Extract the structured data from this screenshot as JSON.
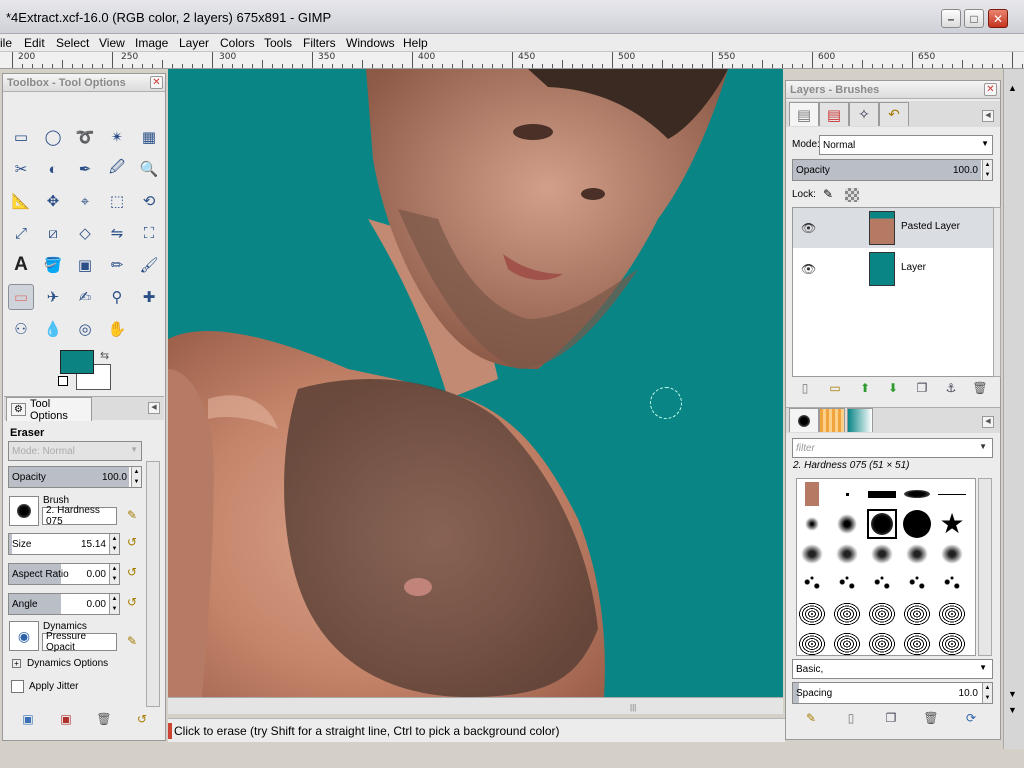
{
  "window": {
    "title": "*4Extract.xcf-16.0 (RGB color, 2 layers) 675x891 - GIMP"
  },
  "menu": [
    "ile",
    "Edit",
    "Select",
    "View",
    "Image",
    "Layer",
    "Colors",
    "Tools",
    "Filters",
    "Windows",
    "Help"
  ],
  "ruler": {
    "labels": [
      "200",
      "250",
      "300",
      "350",
      "400",
      "450",
      "500",
      "550",
      "600",
      "650"
    ]
  },
  "toolbox": {
    "title": "Toolbox - Tool Options",
    "tools": [
      "rect-select",
      "ellipse-select",
      "free-select",
      "fuzzy-select",
      "by-color-select",
      "scissors-select",
      "foreground-select",
      "paths",
      "color-picker",
      "zoom",
      "measure",
      "move",
      "align",
      "crop",
      "rotate",
      "scale",
      "shear",
      "perspective",
      "flip",
      "cage-transform",
      "text",
      "bucket-fill",
      "blend",
      "pencil",
      "paintbrush",
      "eraser",
      "airbrush",
      "ink",
      "clone",
      "heal",
      "perspective-clone",
      "smudge",
      "blur-sharpen",
      "dodge-burn"
    ],
    "selected_tool": "eraser",
    "fg_color": "#0b8383",
    "bg_color": "#ffffff"
  },
  "tool_options": {
    "tab_label": "Tool Options",
    "tool_name": "Eraser",
    "mode_label": "Mode:",
    "mode_value": "Normal",
    "opacity_label": "Opacity",
    "opacity_value": "100.0",
    "brush_label": "Brush",
    "brush_value": "2. Hardness 075",
    "size_label": "Size",
    "size_value": "15.14",
    "aspect_label": "Aspect Ratio",
    "aspect_value": "0.00",
    "angle_label": "Angle",
    "angle_value": "0.00",
    "dynamics_label": "Dynamics",
    "dynamics_value": "Pressure Opacit",
    "dynamics_options_label": "Dynamics Options",
    "apply_jitter_label": "Apply Jitter"
  },
  "status": {
    "message": "Click to erase (try Shift for a straight line, Ctrl to pick a background color)"
  },
  "layers_panel": {
    "title": "Layers - Brushes",
    "mode_label": "Mode:",
    "mode_value": "Normal",
    "opacity_label": "Opacity",
    "opacity_value": "100.0",
    "lock_label": "Lock:",
    "layers": [
      {
        "name": "Pasted Layer",
        "selected": true
      },
      {
        "name": "Layer",
        "selected": false,
        "color": "#098585"
      }
    ]
  },
  "brushes_panel": {
    "filter_placeholder": "filter",
    "selected_brush_label": "2. Hardness 075 (51 × 51)",
    "category_value": "Basic,",
    "spacing_label": "Spacing",
    "spacing_value": "10.0"
  }
}
